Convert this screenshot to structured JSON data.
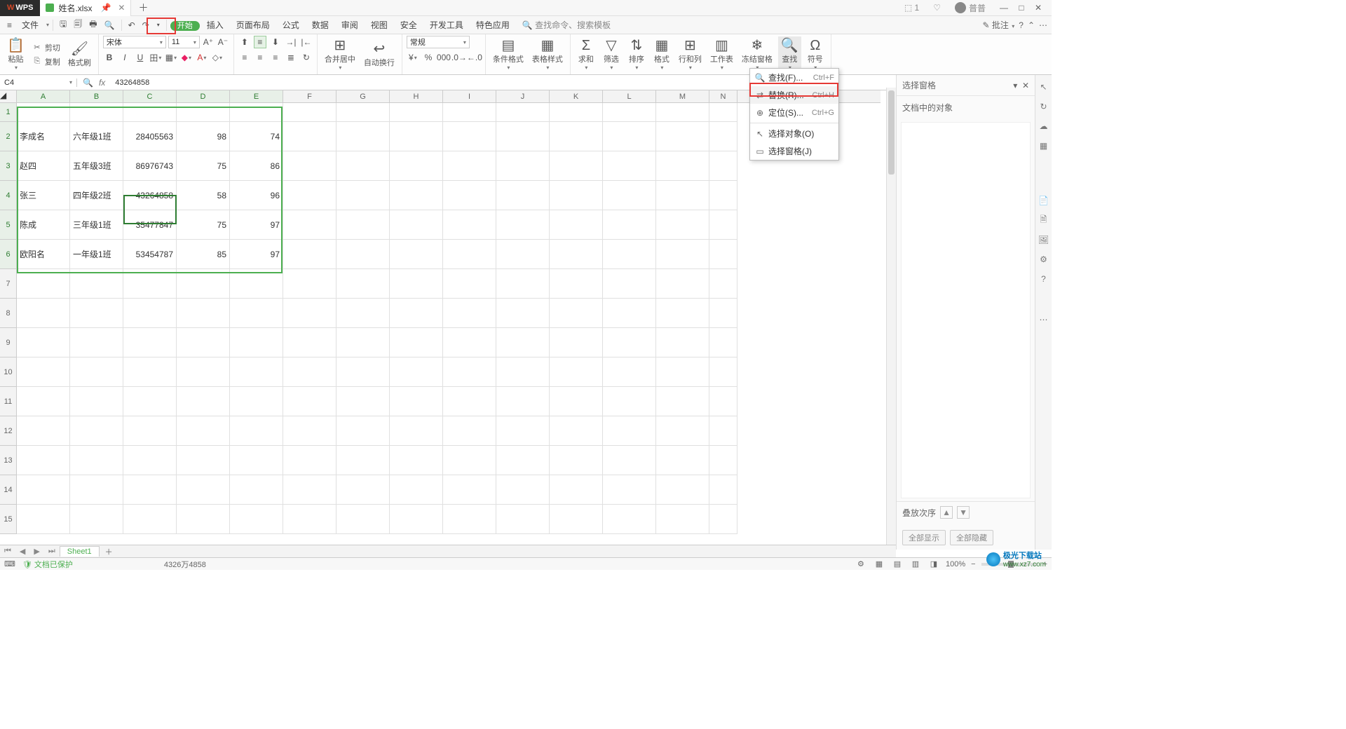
{
  "app": {
    "name": "WPS",
    "tab_filename": "姓名.xlsx",
    "user": "普普"
  },
  "quickbar": {
    "file": "文件"
  },
  "menus": {
    "start": "开始",
    "insert": "插入",
    "page_layout": "页面布局",
    "formula": "公式",
    "data": "数据",
    "review": "审阅",
    "view": "视图",
    "security": "安全",
    "dev": "开发工具",
    "special": "特色应用",
    "search_cmd": "查找命令、搜索模板",
    "annotate": "批注"
  },
  "ribbon": {
    "paste": "粘贴",
    "cut": "剪切",
    "copy": "复制",
    "format_paint": "格式刷",
    "font_name": "宋体",
    "font_size": "11",
    "merge": "合并居中",
    "wrap": "自动换行",
    "number_format": "常规",
    "cond_fmt": "条件格式",
    "table_style": "表格样式",
    "sum": "求和",
    "filter": "筛选",
    "sort": "排序",
    "format": "格式",
    "rowcol": "行和列",
    "worksheet": "工作表",
    "freeze": "冻结窗格",
    "find": "查找",
    "symbol": "符号"
  },
  "dropdown": {
    "find": "查找(F)...",
    "find_sc": "Ctrl+F",
    "replace": "替换(R)...",
    "replace_sc": "Ctrl+H",
    "goto": "定位(S)...",
    "goto_sc": "Ctrl+G",
    "sel_obj": "选择对象(O)",
    "sel_pane": "选择窗格(J)"
  },
  "formula_bar": {
    "cell_ref": "C4",
    "value": "43264858"
  },
  "columns": [
    "A",
    "B",
    "C",
    "D",
    "E",
    "F",
    "G",
    "H",
    "I",
    "J",
    "K",
    "L",
    "M",
    "N"
  ],
  "rows": [
    {
      "r": 1,
      "cells": [
        "",
        "",
        "",
        "",
        ""
      ]
    },
    {
      "r": 2,
      "cells": [
        "李成名",
        "六年级1班",
        "28405563",
        "98",
        "74"
      ]
    },
    {
      "r": 3,
      "cells": [
        "赵四",
        "五年级3班",
        "86976743",
        "75",
        "86"
      ]
    },
    {
      "r": 4,
      "cells": [
        "张三",
        "四年级2班",
        "43264858",
        "58",
        "96"
      ]
    },
    {
      "r": 5,
      "cells": [
        "陈成",
        "三年级1班",
        "35477847",
        "75",
        "97"
      ]
    },
    {
      "r": 6,
      "cells": [
        "欧阳名",
        "一年级1班",
        "53454787",
        "85",
        "97"
      ]
    }
  ],
  "empty_rows": [
    7,
    8,
    9,
    10,
    11,
    12,
    13,
    14,
    15
  ],
  "sheet_name": "Sheet1",
  "right_panel": {
    "title": "选择窗格",
    "subtitle": "文档中的对象",
    "stack_label": "叠放次序",
    "show_all": "全部显示",
    "hide_all": "全部隐藏"
  },
  "status": {
    "protected": "文档已保护",
    "calc": "4326万4858",
    "zoom": "100%"
  },
  "watermark": {
    "top": "极光下载站",
    "bottom": "www.xz7.com"
  }
}
